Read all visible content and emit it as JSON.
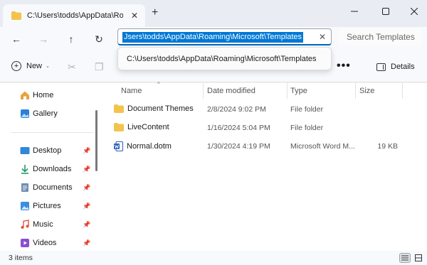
{
  "tab": {
    "title": "C:\\Users\\todds\\AppData\\Roam",
    "close": "✕"
  },
  "new_tab": "+",
  "window": {
    "minimize": "—",
    "maximize": "☐",
    "close": "✕"
  },
  "nav": {
    "back": "←",
    "forward": "→",
    "up": "↑",
    "refresh": "↻"
  },
  "address": {
    "value": "Jsers\\todds\\AppData\\Roaming\\Microsoft\\Templates",
    "clear": "✕"
  },
  "search": {
    "placeholder": "Search Templates"
  },
  "dropdown": {
    "suggestion": "C:\\Users\\todds\\AppData\\Roaming\\Microsoft\\Templates"
  },
  "toolbar": {
    "new_label": "New",
    "new_chevron": "⌄",
    "more": "•••",
    "details_label": "Details"
  },
  "sidebar": {
    "items": [
      {
        "label": "Home",
        "icon": "home-icon"
      },
      {
        "label": "Gallery",
        "icon": "gallery-icon"
      },
      {
        "label": "Desktop",
        "icon": "desktop-icon",
        "pinned": true
      },
      {
        "label": "Downloads",
        "icon": "downloads-icon",
        "pinned": true
      },
      {
        "label": "Documents",
        "icon": "documents-icon",
        "pinned": true
      },
      {
        "label": "Pictures",
        "icon": "pictures-icon",
        "pinned": true
      },
      {
        "label": "Music",
        "icon": "music-icon",
        "pinned": true
      },
      {
        "label": "Videos",
        "icon": "videos-icon",
        "pinned": true
      }
    ],
    "pin_glyph": "📌"
  },
  "columns": {
    "name": "Name",
    "date": "Date modified",
    "type": "Type",
    "size": "Size",
    "sort_glyph": "^"
  },
  "files": [
    {
      "name": "Document Themes",
      "date": "2/8/2024 9:02 PM",
      "type": "File folder",
      "size": "",
      "icon": "folder-icon"
    },
    {
      "name": "LiveContent",
      "date": "1/16/2024 5:04 PM",
      "type": "File folder",
      "size": "",
      "icon": "folder-icon"
    },
    {
      "name": "Normal.dotm",
      "date": "1/30/2024 4:19 PM",
      "type": "Microsoft Word M...",
      "size": "19 KB",
      "icon": "word-template-icon"
    }
  ],
  "status": {
    "item_count": "3 items"
  },
  "colors": {
    "accent": "#0078d4",
    "folder": "#f3c34b",
    "word": "#2b5eb3"
  }
}
